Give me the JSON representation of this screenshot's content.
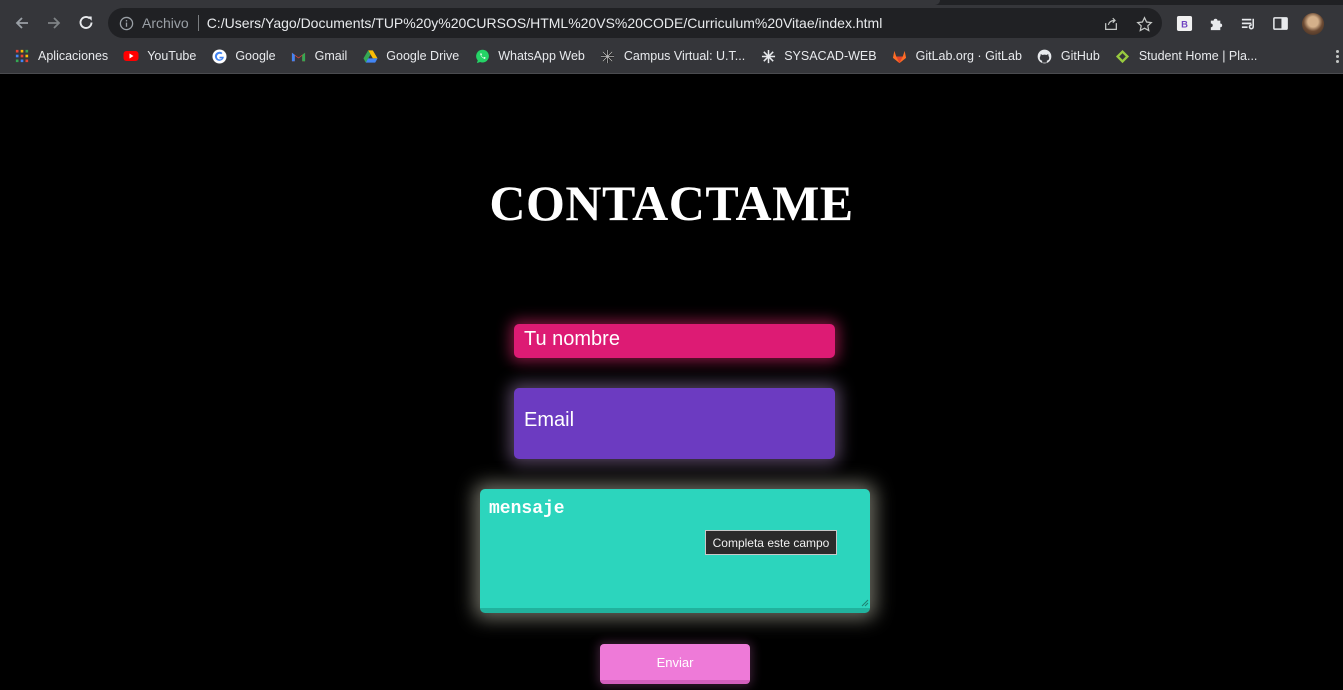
{
  "browser": {
    "nav": {
      "back_icon": "arrow-left-icon",
      "forward_icon": "arrow-right-icon",
      "reload_icon": "reload-icon"
    },
    "omnibox": {
      "security_chip": "Archivo",
      "url": "C:/Users/Yago/Documents/TUP%20y%20CURSOS/HTML%20VS%20CODE/Curriculum%20Vitae/index.html"
    },
    "bookmarks": [
      {
        "label": "Aplicaciones",
        "icon": "apps-grid-icon"
      },
      {
        "label": "YouTube",
        "icon": "youtube-icon"
      },
      {
        "label": "Google",
        "icon": "google-icon"
      },
      {
        "label": "Gmail",
        "icon": "gmail-icon"
      },
      {
        "label": "Google Drive",
        "icon": "google-drive-icon"
      },
      {
        "label": "WhatsApp Web",
        "icon": "whatsapp-icon"
      },
      {
        "label": "Campus Virtual: U.T...",
        "icon": "utn-icon"
      },
      {
        "label": "SYSACAD-WEB",
        "icon": "utn-icon"
      },
      {
        "label": "GitLab.org · GitLab",
        "icon": "gitlab-icon"
      },
      {
        "label": "GitHub",
        "icon": "github-icon"
      },
      {
        "label": "Student Home | Pla...",
        "icon": "platzi-icon"
      }
    ]
  },
  "page": {
    "title": "CONTACTAME",
    "form": {
      "name_placeholder": "Tu nombre",
      "email_placeholder": "Email",
      "message_placeholder": "mensaje",
      "validation_tooltip": "Completa este campo",
      "submit_label": "Enviar"
    }
  },
  "colors": {
    "background": "#000000",
    "name_field": "#dd1b74",
    "email_field": "#6c3bc1",
    "message_field": "#2cd5bd",
    "submit_button": "#ee7ad8"
  }
}
